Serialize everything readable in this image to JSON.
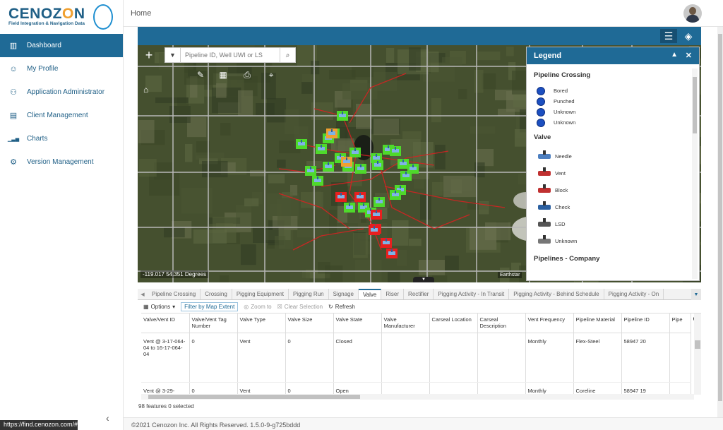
{
  "app": {
    "brand_left": "CENOZ",
    "brand_o": "O",
    "brand_right": "N",
    "tagline": "Field Integration & Navigation Data"
  },
  "header": {
    "title": "Home"
  },
  "sidebar": {
    "items": [
      {
        "label": "Dashboard",
        "icon": "map-icon",
        "active": true
      },
      {
        "label": "My Profile",
        "icon": "user-icon"
      },
      {
        "label": "Application Administrator",
        "icon": "admin-icon"
      },
      {
        "label": "Client Management",
        "icon": "building-icon"
      },
      {
        "label": "Charts",
        "icon": "bar-chart-icon"
      },
      {
        "label": "Version Management",
        "icon": "gear-icon"
      }
    ],
    "status_url": "https://find.cenozon.com/#/"
  },
  "map": {
    "search_placeholder": "Pipeline ID, Well UWI or LS",
    "coords": "-119.017 54.351 Degrees",
    "attribution": "Earthstar"
  },
  "legend": {
    "title": "Legend",
    "sections": [
      {
        "title": "Pipeline Crossing",
        "items": [
          "Bored",
          "Punched",
          "Unknown",
          "Unknown"
        ]
      },
      {
        "title": "Valve",
        "items": [
          "Needle",
          "Vent",
          "Block",
          "Check",
          "LSD",
          "Unknown"
        ]
      },
      {
        "title": "Pipelines - Company"
      }
    ]
  },
  "tabs": [
    "Pipeline Crossing",
    "Crossing",
    "Pigging Equipment",
    "Pigging Run",
    "Signage",
    "Valve",
    "Riser",
    "Rectifier",
    "Pigging Activity - In Transit",
    "Pigging Activity - Behind Schedule",
    "Pigging Activity - On"
  ],
  "active_tab": "Valve",
  "toolbar": {
    "options": "Options",
    "filter": "Filter by Map Extent",
    "zoom": "Zoom to",
    "clear": "Clear Selection",
    "refresh": "Refresh"
  },
  "table": {
    "columns": [
      "Valve/Vent ID",
      "Valve/Vent Tag Number",
      "Valve Type",
      "Valve Size",
      "Valve State",
      "Valve Manufacturer",
      "Carseal Location",
      "Carseal Description",
      "Vent Frequency",
      "Pipeline Material",
      "Pipeline ID",
      "Pipe"
    ],
    "rows": [
      [
        "Vent @ 3-17-064-04 to 16-17-064-04",
        "0",
        "Vent",
        "0",
        "Closed",
        "",
        "",
        "",
        "Monthly",
        "Flex-Steel",
        "58947 20",
        ""
      ],
      [
        "Vent @ 3-29-",
        "0",
        "Vent",
        "0",
        "Open",
        "",
        "",
        "",
        "Monthly",
        "Coreline",
        "58947 19",
        ""
      ]
    ]
  },
  "summary": "98 features 0 selected",
  "footer": "©2021 Cenozon Inc. All Rights Reserved. 1.5.0-9-g725bddd"
}
